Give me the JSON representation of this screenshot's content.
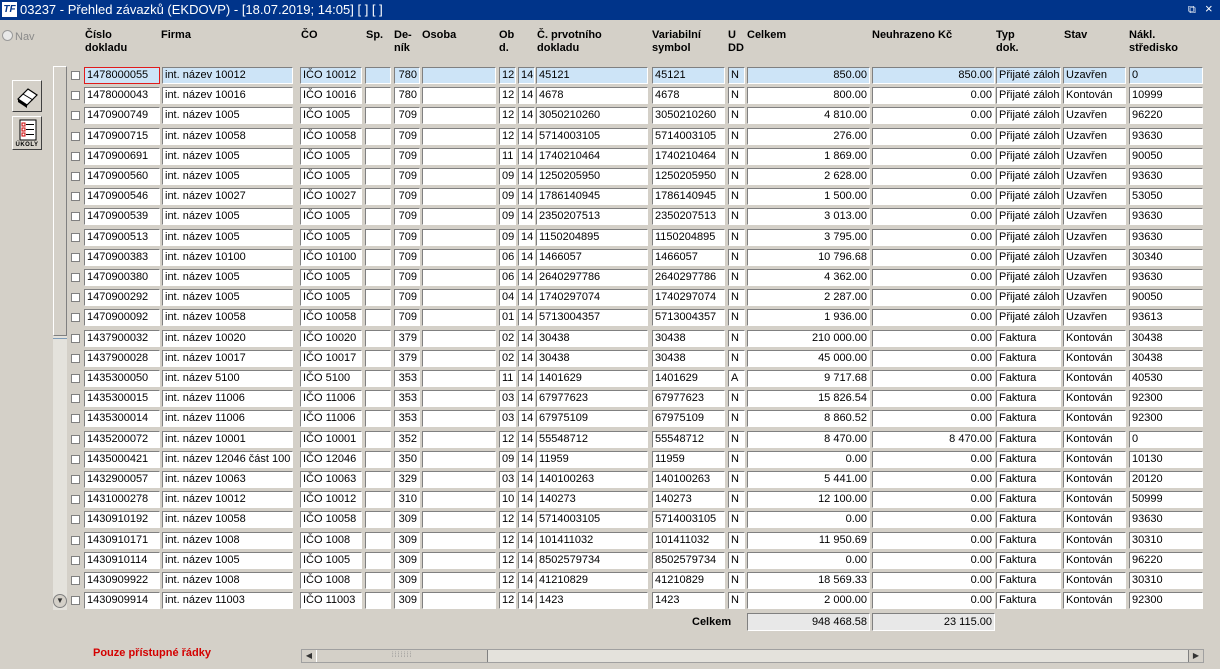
{
  "window": {
    "title": "03237 - Přehled závazků (EKDOVP) - [18.07.2019; 14:05]  [ ]  [ ]",
    "app_icon": "TF",
    "restore_glyph": "⧉",
    "close_glyph": "×"
  },
  "nav": {
    "label": "Nav"
  },
  "tools": {
    "tasks_label": "ÚKOLY"
  },
  "table": {
    "columns": [
      {
        "key": "cislo",
        "label": "Číslo\ndokladu"
      },
      {
        "key": "firma",
        "label": "Firma"
      },
      {
        "key": "ico",
        "label": "ČO"
      },
      {
        "key": "sp",
        "label": "Sp."
      },
      {
        "key": "denik",
        "label": "De-\nník"
      },
      {
        "key": "osoba",
        "label": "Osoba"
      },
      {
        "key": "obd",
        "label": "Ob\nd."
      },
      {
        "key": "prv",
        "label": "Č. prvotního\ndokladu"
      },
      {
        "key": "vs",
        "label": "Variabilní\nsymbol"
      },
      {
        "key": "udd",
        "label": "U\nDD"
      },
      {
        "key": "celkem",
        "label": "Celkem"
      },
      {
        "key": "neuhr",
        "label": "Neuhrazeno Kč"
      },
      {
        "key": "typ",
        "label": "Typ\ndok."
      },
      {
        "key": "stav",
        "label": "Stav"
      },
      {
        "key": "nakl",
        "label": "Nákl.\nstředisko"
      }
    ],
    "rows": [
      [
        "1478000055",
        "int. název 10012",
        "IČO 10012",
        "",
        "780",
        "",
        "12",
        "14",
        "45121",
        "45121",
        "N",
        "850.00",
        "850.00",
        "Přijaté zálohov",
        "Uzavřen",
        "0"
      ],
      [
        "1478000043",
        "int. název 10016",
        "IČO 10016",
        "",
        "780",
        "",
        "12",
        "14",
        "4678",
        "4678",
        "N",
        "800.00",
        "0.00",
        "Přijaté zálohov",
        "Kontován",
        "10999"
      ],
      [
        "1470900749",
        "int. název 1005",
        "IČO 1005",
        "",
        "709",
        "",
        "12",
        "14",
        "3050210260",
        "3050210260",
        "N",
        "4 810.00",
        "0.00",
        "Přijaté zálohov",
        "Uzavřen",
        "96220"
      ],
      [
        "1470900715",
        "int. název 10058",
        "IČO 10058",
        "",
        "709",
        "",
        "12",
        "14",
        "5714003105",
        "5714003105",
        "N",
        "276.00",
        "0.00",
        "Přijaté zálohov",
        "Uzavřen",
        "93630"
      ],
      [
        "1470900691",
        "int. název 1005",
        "IČO 1005",
        "",
        "709",
        "",
        "11",
        "14",
        "1740210464",
        "1740210464",
        "N",
        "1 869.00",
        "0.00",
        "Přijaté zálohov",
        "Uzavřen",
        "90050"
      ],
      [
        "1470900560",
        "int. název 1005",
        "IČO 1005",
        "",
        "709",
        "",
        "09",
        "14",
        "1250205950",
        "1250205950",
        "N",
        "2 628.00",
        "0.00",
        "Přijaté zálohov",
        "Uzavřen",
        "93630"
      ],
      [
        "1470900546",
        "int. název 10027",
        "IČO 10027",
        "",
        "709",
        "",
        "09",
        "14",
        "1786140945",
        "1786140945",
        "N",
        "1 500.00",
        "0.00",
        "Přijaté zálohov",
        "Uzavřen",
        "53050"
      ],
      [
        "1470900539",
        "int. název 1005",
        "IČO 1005",
        "",
        "709",
        "",
        "09",
        "14",
        "2350207513",
        "2350207513",
        "N",
        "3 013.00",
        "0.00",
        "Přijaté zálohov",
        "Uzavřen",
        "93630"
      ],
      [
        "1470900513",
        "int. název 1005",
        "IČO 1005",
        "",
        "709",
        "",
        "09",
        "14",
        "1150204895",
        "1150204895",
        "N",
        "3 795.00",
        "0.00",
        "Přijaté zálohov",
        "Uzavřen",
        "93630"
      ],
      [
        "1470900383",
        "int. název 10100",
        "IČO 10100",
        "",
        "709",
        "",
        "06",
        "14",
        "1466057",
        "1466057",
        "N",
        "10 796.68",
        "0.00",
        "Přijaté zálohov",
        "Uzavřen",
        "30340"
      ],
      [
        "1470900380",
        "int. název 1005",
        "IČO 1005",
        "",
        "709",
        "",
        "06",
        "14",
        "2640297786",
        "2640297786",
        "N",
        "4 362.00",
        "0.00",
        "Přijaté zálohov",
        "Uzavřen",
        "93630"
      ],
      [
        "1470900292",
        "int. název 1005",
        "IČO 1005",
        "",
        "709",
        "",
        "04",
        "14",
        "1740297074",
        "1740297074",
        "N",
        "2 287.00",
        "0.00",
        "Přijaté zálohov",
        "Uzavřen",
        "90050"
      ],
      [
        "1470900092",
        "int. název 10058",
        "IČO 10058",
        "",
        "709",
        "",
        "01",
        "14",
        "5713004357",
        "5713004357",
        "N",
        "1 936.00",
        "0.00",
        "Přijaté zálohov",
        "Uzavřen",
        "93613"
      ],
      [
        "1437900032",
        "int. název 10020",
        "IČO 10020",
        "",
        "379",
        "",
        "02",
        "14",
        "30438",
        "30438",
        "N",
        "210 000.00",
        "0.00",
        "Faktura",
        "Kontován",
        "30438"
      ],
      [
        "1437900028",
        "int. název 10017",
        "IČO 10017",
        "",
        "379",
        "",
        "02",
        "14",
        "30438",
        "30438",
        "N",
        "45 000.00",
        "0.00",
        "Faktura",
        "Kontován",
        "30438"
      ],
      [
        "1435300050",
        "int. název 5100",
        "IČO 5100",
        "",
        "353",
        "",
        "11",
        "14",
        "1401629",
        "1401629",
        "A",
        "9 717.68",
        "0.00",
        "Faktura",
        "Kontován",
        "40530"
      ],
      [
        "1435300015",
        "int. název 11006",
        "IČO 11006",
        "",
        "353",
        "",
        "03",
        "14",
        "67977623",
        "67977623",
        "N",
        "15 826.54",
        "0.00",
        "Faktura",
        "Kontován",
        "92300"
      ],
      [
        "1435300014",
        "int. název 11006",
        "IČO 11006",
        "",
        "353",
        "",
        "03",
        "14",
        "67975109",
        "67975109",
        "N",
        "8 860.52",
        "0.00",
        "Faktura",
        "Kontován",
        "92300"
      ],
      [
        "1435200072",
        "int. název 10001",
        "IČO 10001",
        "",
        "352",
        "",
        "12",
        "14",
        "55548712",
        "55548712",
        "N",
        "8 470.00",
        "8 470.00",
        "Faktura",
        "Kontován",
        "0"
      ],
      [
        "1435000421",
        "int. název 12046 část 100",
        "IČO 12046",
        "",
        "350",
        "",
        "09",
        "14",
        "11959",
        "11959",
        "N",
        "0.00",
        "0.00",
        "Faktura",
        "Kontován",
        "10130"
      ],
      [
        "1432900057",
        "int. název 10063",
        "IČO 10063",
        "",
        "329",
        "",
        "03",
        "14",
        "140100263",
        "140100263",
        "N",
        "5 441.00",
        "0.00",
        "Faktura",
        "Kontován",
        "20120"
      ],
      [
        "1431000278",
        "int. název 10012",
        "IČO 10012",
        "",
        "310",
        "",
        "10",
        "14",
        "140273",
        "140273",
        "N",
        "12 100.00",
        "0.00",
        "Faktura",
        "Kontován",
        "50999"
      ],
      [
        "1430910192",
        "int. název 10058",
        "IČO 10058",
        "",
        "309",
        "",
        "12",
        "14",
        "5714003105",
        "5714003105",
        "N",
        "0.00",
        "0.00",
        "Faktura",
        "Kontován",
        "93630"
      ],
      [
        "1430910171",
        "int. název 1008",
        "IČO 1008",
        "",
        "309",
        "",
        "12",
        "14",
        "101411032",
        "101411032",
        "N",
        "11 950.69",
        "0.00",
        "Faktura",
        "Kontován",
        "30310"
      ],
      [
        "1430910114",
        "int. název 1005",
        "IČO 1005",
        "",
        "309",
        "",
        "12",
        "14",
        "8502579734",
        "8502579734",
        "N",
        "0.00",
        "0.00",
        "Faktura",
        "Kontován",
        "96220"
      ],
      [
        "1430909922",
        "int. název 1008",
        "IČO 1008",
        "",
        "309",
        "",
        "12",
        "14",
        "41210829",
        "41210829",
        "N",
        "18 569.33",
        "0.00",
        "Faktura",
        "Kontován",
        "30310"
      ],
      [
        "1430909914",
        "int. název 11003",
        "IČO 11003",
        "",
        "309",
        "",
        "12",
        "14",
        "1423",
        "1423",
        "N",
        "2 000.00",
        "0.00",
        "Faktura",
        "Kontován",
        "92300"
      ]
    ]
  },
  "totals": {
    "label": "Celkem",
    "celkem": "948 468.58",
    "neuhrazeno": "23 115.00"
  },
  "footer": {
    "note": "Pouze přístupné řádky"
  },
  "colors": {
    "titlebar": "#00348a",
    "selected_row": "#cde4f7",
    "note": "#d40000"
  }
}
